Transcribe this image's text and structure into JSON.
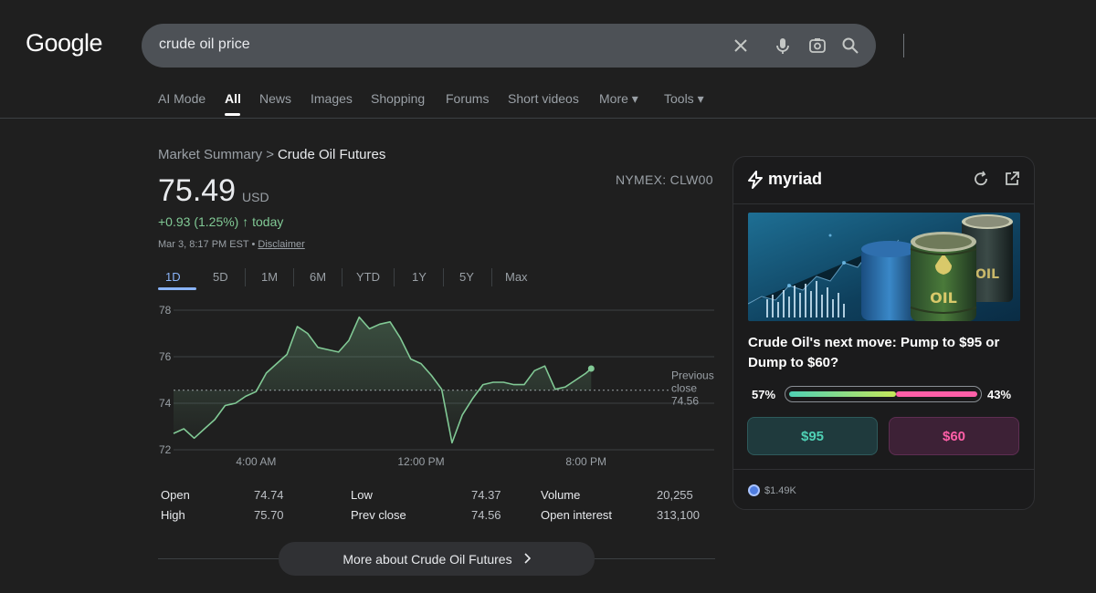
{
  "header": {
    "logo": "Google",
    "search_query": "crude oil price",
    "icons": [
      "close-icon",
      "mic-icon",
      "camera-lens-icon",
      "search-icon"
    ]
  },
  "tabs": [
    {
      "label": "AI Mode"
    },
    {
      "label": "All",
      "active": true
    },
    {
      "label": "News"
    },
    {
      "label": "Images"
    },
    {
      "label": "Shopping"
    },
    {
      "label": "Forums"
    },
    {
      "label": "Short videos"
    },
    {
      "label": "More ▾"
    },
    {
      "label": "Tools ▾"
    }
  ],
  "market": {
    "breadcrumb_root": "Market Summary",
    "breadcrumb_sep": ">",
    "breadcrumb_current": "Crude Oil Futures",
    "exchange": "NYMEX: CLW00",
    "price": "75.49",
    "currency": "USD",
    "change": "+0.93 (1.25%) ↑ today",
    "timestamp": "Mar 3, 8:17 PM EST • ",
    "disclaimer": "Disclaimer",
    "ranges": [
      "1D",
      "5D",
      "1M",
      "6M",
      "YTD",
      "1Y",
      "5Y",
      "Max"
    ],
    "active_range": "1D",
    "stats": [
      {
        "label": "Open",
        "value": "74.74"
      },
      {
        "label": "High",
        "value": "75.70"
      },
      {
        "label": "Low",
        "value": "74.37"
      },
      {
        "label": "Prev close",
        "value": "74.56"
      },
      {
        "label": "Volume",
        "value": "20,255"
      },
      {
        "label": "Open interest",
        "value": "313,100"
      }
    ],
    "more_button": "More about Crude Oil Futures"
  },
  "chart_data": {
    "type": "line",
    "y_ticks": [
      "78",
      "76",
      "74",
      "72"
    ],
    "x_ticks": [
      "4:00 AM",
      "12:00 PM",
      "8:00 PM"
    ],
    "ylim": [
      72,
      78
    ],
    "previous_close": 74.56,
    "previous_close_label": [
      "Previous",
      "close",
      "74.56"
    ],
    "line_color": "#81c995",
    "series": [
      {
        "x": [
          "00:00",
          "00:30",
          "01:00",
          "01:30",
          "02:00",
          "02:30",
          "03:00",
          "03:30",
          "04:00",
          "04:30",
          "05:00",
          "05:30",
          "06:00",
          "06:30",
          "07:00",
          "07:30",
          "08:00",
          "08:30",
          "09:00",
          "09:30",
          "10:00",
          "10:30",
          "11:00",
          "11:30",
          "12:00",
          "12:30",
          "13:00",
          "13:30",
          "14:00",
          "14:30",
          "15:00",
          "15:30",
          "16:00",
          "16:30",
          "17:00",
          "17:30",
          "18:00",
          "18:30",
          "19:00",
          "19:30",
          "20:00",
          "20:15"
        ],
        "values": [
          72.7,
          72.9,
          72.5,
          72.9,
          73.3,
          73.9,
          74.0,
          74.3,
          74.5,
          75.3,
          75.7,
          76.1,
          77.3,
          77.0,
          76.4,
          76.3,
          76.2,
          76.7,
          77.7,
          77.2,
          77.4,
          77.5,
          76.8,
          75.9,
          75.7,
          75.2,
          74.6,
          72.3,
          73.5,
          74.2,
          74.8,
          74.9,
          74.9,
          74.8,
          74.8,
          75.4,
          75.6,
          74.6,
          74.7,
          75.0,
          75.3,
          75.49
        ]
      }
    ]
  },
  "myriad_card": {
    "brand": "myriad",
    "image_text": "OIL",
    "title": "Crude Oil's next move: Pump to $95 or Dump to $60?",
    "left_pct": "57%",
    "right_pct": "43%",
    "yes_fraction": 0.57,
    "option_a": "$95",
    "option_b": "$60",
    "volume": "$1.49K",
    "colors": {
      "option_a": "#4fd1b5",
      "option_b": "#ff5fa8"
    }
  }
}
